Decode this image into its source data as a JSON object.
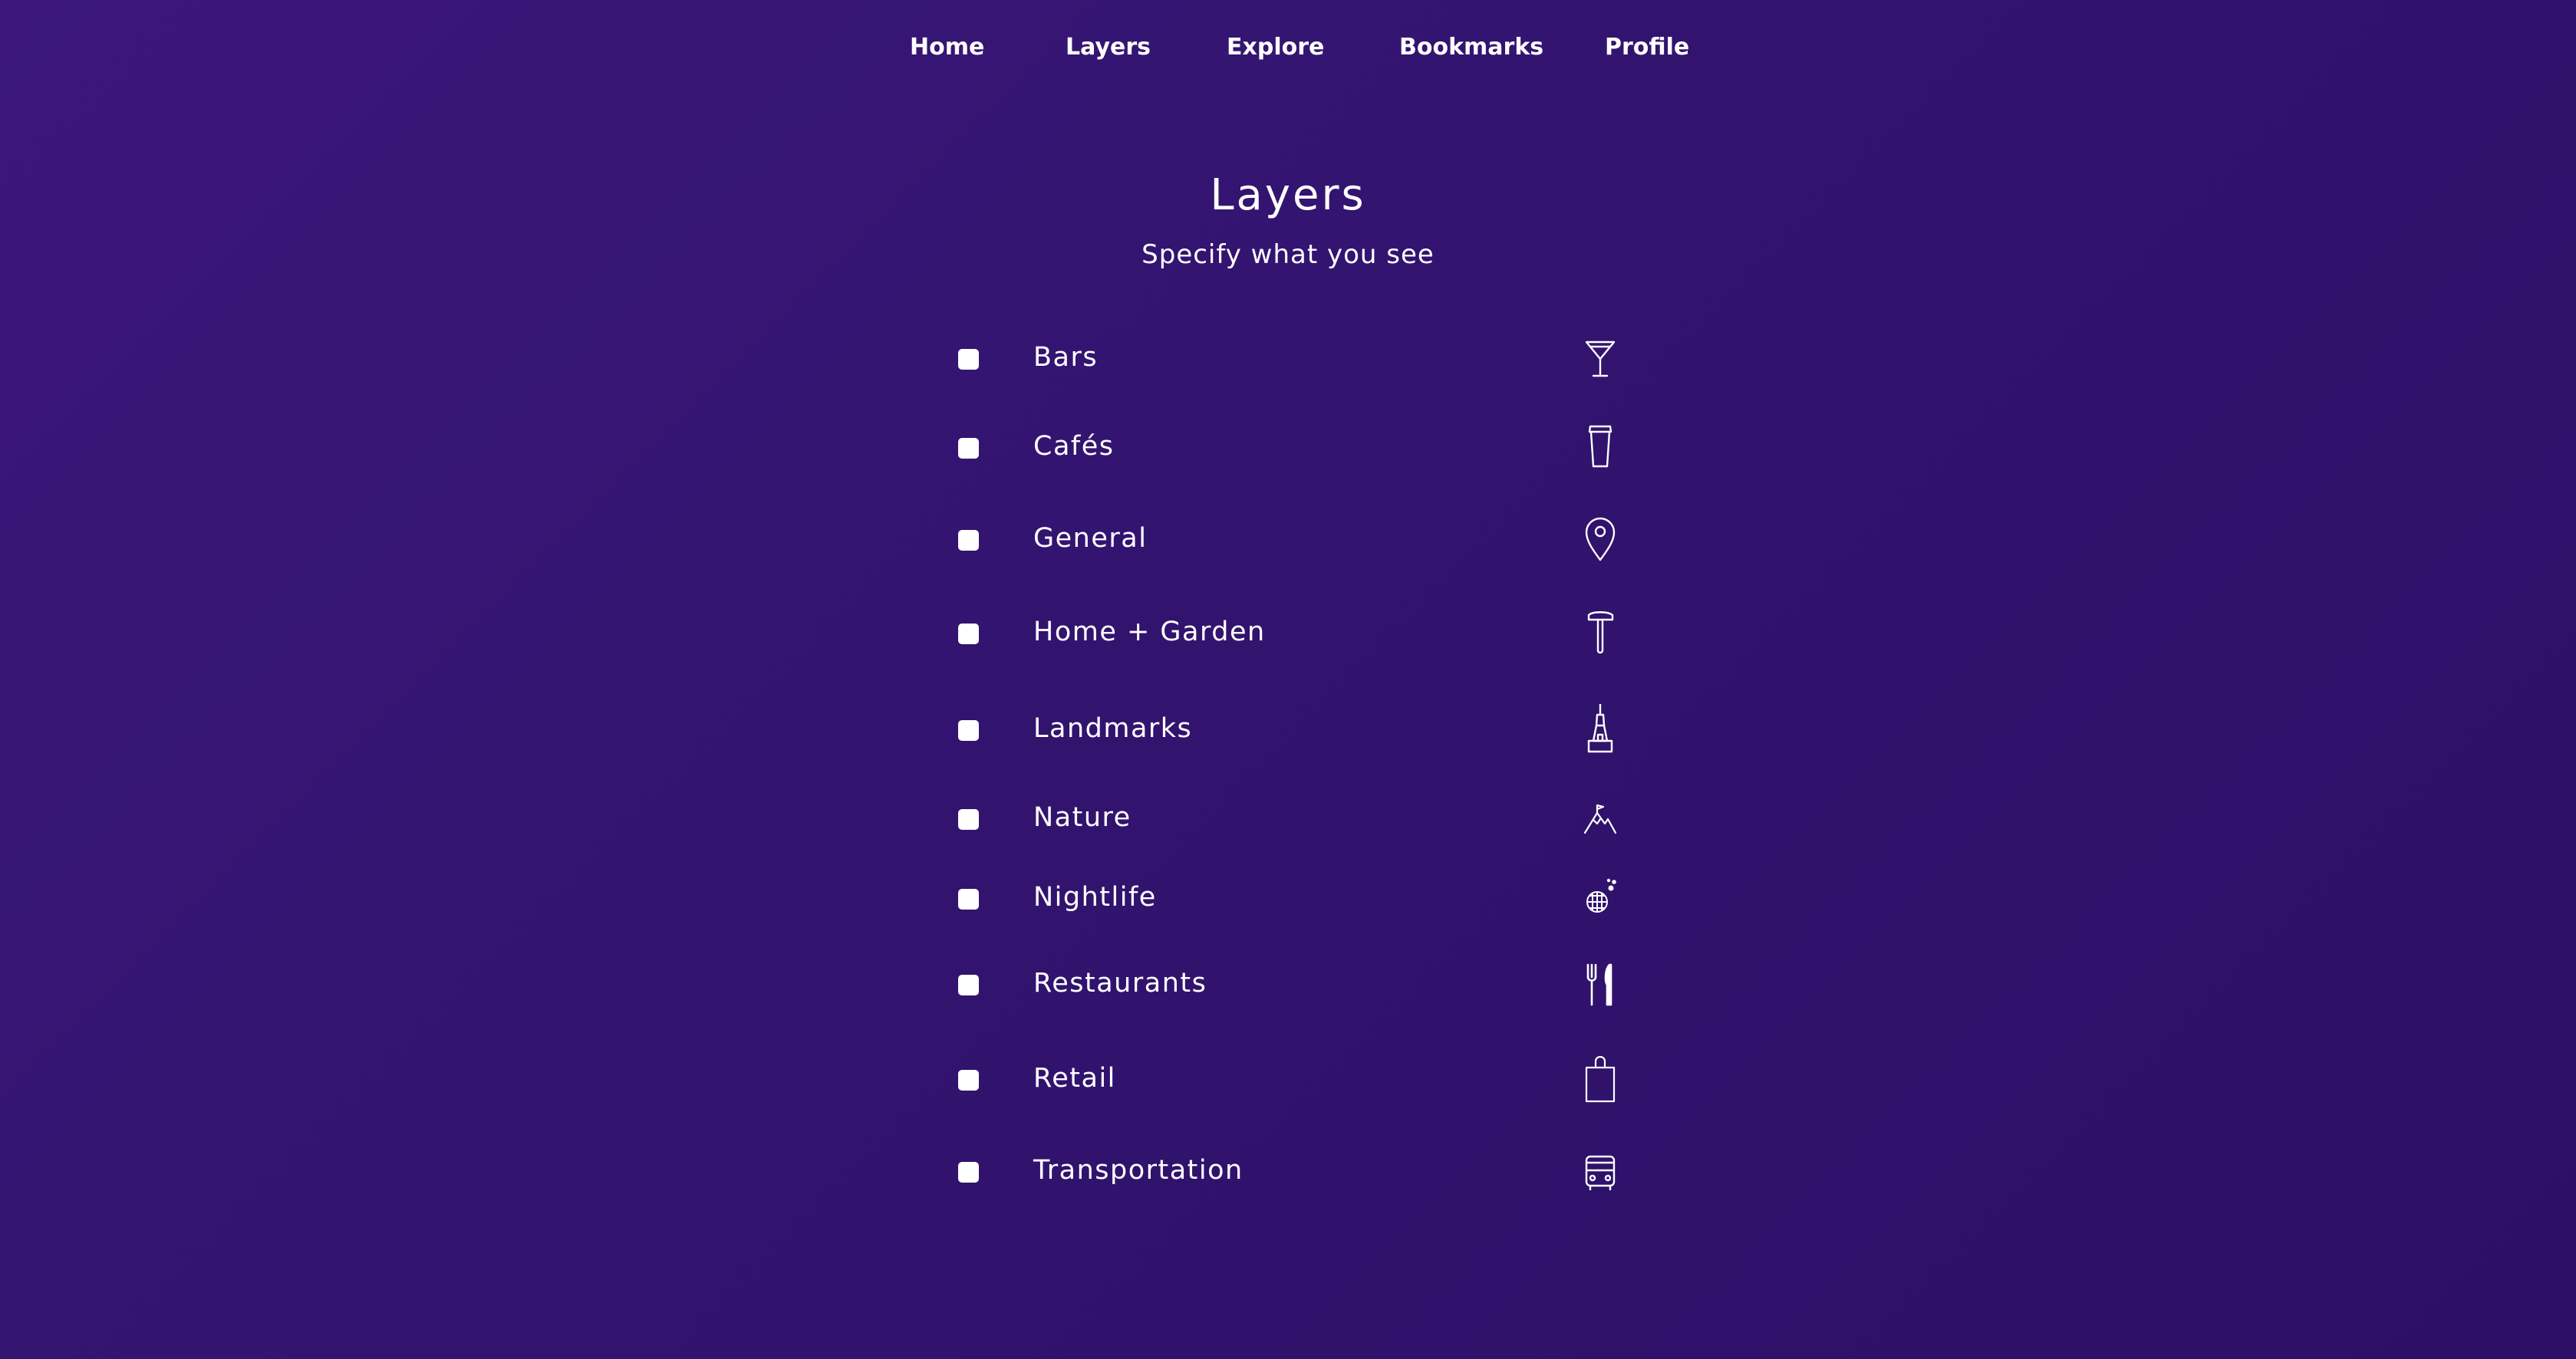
{
  "nav": {
    "items": [
      {
        "label": "Home"
      },
      {
        "label": "Layers"
      },
      {
        "label": "Explore"
      },
      {
        "label": "Bookmarks"
      },
      {
        "label": "Profile"
      }
    ]
  },
  "header": {
    "title": "Layers",
    "subtitle": "Specify what you see"
  },
  "layers": [
    {
      "label": "Bars",
      "icon": "cocktail-glass-icon",
      "checked": false
    },
    {
      "label": "Cafés",
      "icon": "coffee-cup-icon",
      "checked": false
    },
    {
      "label": "General",
      "icon": "map-pin-icon",
      "checked": false
    },
    {
      "label": "Home + Garden",
      "icon": "hammer-icon",
      "checked": false
    },
    {
      "label": "Landmarks",
      "icon": "tower-icon",
      "checked": false
    },
    {
      "label": "Nature",
      "icon": "mountain-flag-icon",
      "checked": false
    },
    {
      "label": "Nightlife",
      "icon": "disco-ball-icon",
      "checked": false
    },
    {
      "label": "Restaurants",
      "icon": "fork-knife-icon",
      "checked": false
    },
    {
      "label": "Retail",
      "icon": "shopping-bag-icon",
      "checked": false
    },
    {
      "label": "Transportation",
      "icon": "bus-icon",
      "checked": false
    }
  ],
  "colors": {
    "background_start": "#3b177a",
    "background_end": "#2c0f66",
    "text": "#ffffff"
  }
}
